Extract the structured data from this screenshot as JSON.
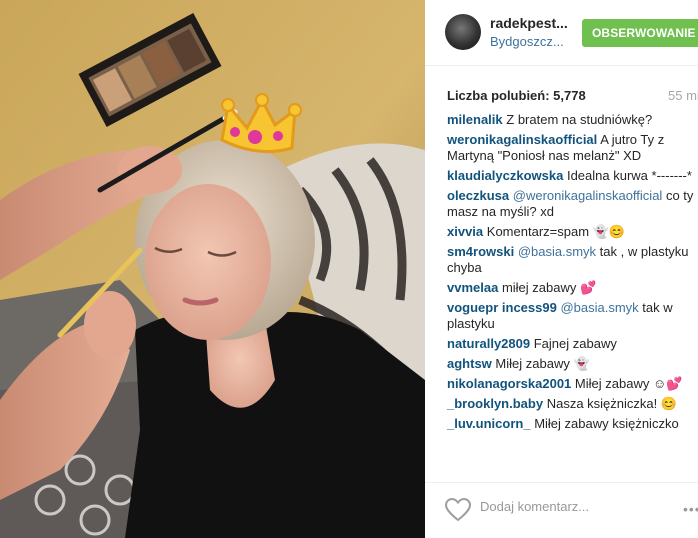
{
  "post": {
    "username": "radekpest...",
    "location": "Bydgoszcz...",
    "follow_label": "OBSERWOWANIE",
    "likes_label": "Liczba polubień: 5,778",
    "time": "55 mi",
    "comment_placeholder": "Dodaj komentarz...",
    "more_label": "•••"
  },
  "comments": [
    {
      "user": "milenalik",
      "text": "Z bratem na studniówkę?"
    },
    {
      "user": "weronikagalinskaofficial",
      "text": "A jutro Ty z Martyną \"Poniosł nas melanż\" XD"
    },
    {
      "user": "klaudialyczkowska",
      "text": "Idealna kurwa *-------*"
    },
    {
      "user": "oleczkusa",
      "mention": "@weronikagalinskaofficial",
      "text": "co ty masz na myśli? xd"
    },
    {
      "user": "xivvia",
      "text": "Komentarz=spam 👻😊"
    },
    {
      "user": "sm4rowski",
      "mention": "@basia.smyk",
      "text": "tak , w plastyku chyba"
    },
    {
      "user": "vvmelaa",
      "text": "miłej zabawy 💕"
    },
    {
      "user": "voguepr incess99",
      "mention": "@basia.smyk",
      "text": "tak w plastyku"
    },
    {
      "user": "naturally2809",
      "text": "Fajnej zabawy"
    },
    {
      "user": "aghtsw",
      "text": "Miłej zabawy 👻"
    },
    {
      "user": "nikolanagorska2001",
      "text": "Miłej zabawy ☺💕"
    },
    {
      "user": "_brooklyn.baby",
      "text": "Nasza księżniczka! 😊"
    },
    {
      "user": "_luv.unicorn_",
      "text": "Miłej zabawy księżniczko"
    }
  ],
  "colors": {
    "follow": "#70c050",
    "username": "#12537d",
    "location": "#3f729b"
  },
  "icons": {
    "like": "heart-icon",
    "more": "more-options-icon"
  }
}
